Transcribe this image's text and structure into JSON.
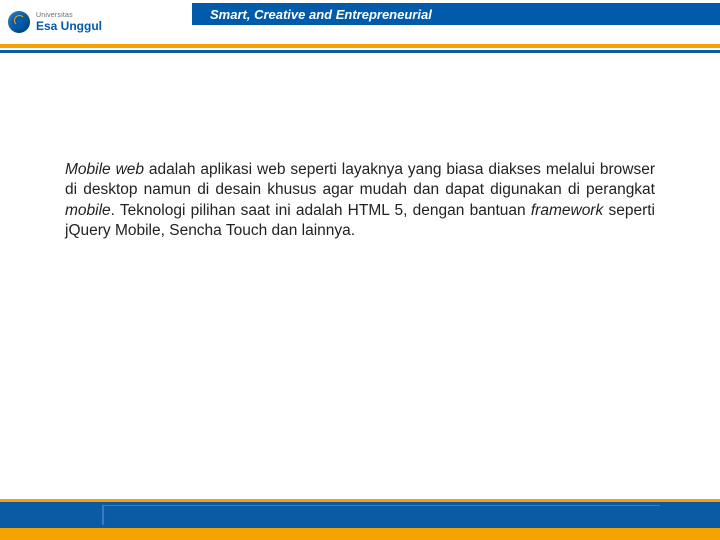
{
  "header": {
    "university_small": "Universitas",
    "university_name": "Esa Unggul",
    "tagline": "Smart, Creative and Entrepreneurial"
  },
  "body": {
    "paragraph_html": "<em>Mobile web</em> adalah aplikasi web seperti layaknya yang biasa diakses melalui browser di desktop namun di desain khusus agar mudah dan dapat digunakan di perangkat <em>mobile</em>. Teknologi pilihan saat ini adalah HTML 5, dengan bantuan <em>framework</em> seperti jQuery Mobile, Sencha Touch dan lainnya."
  }
}
